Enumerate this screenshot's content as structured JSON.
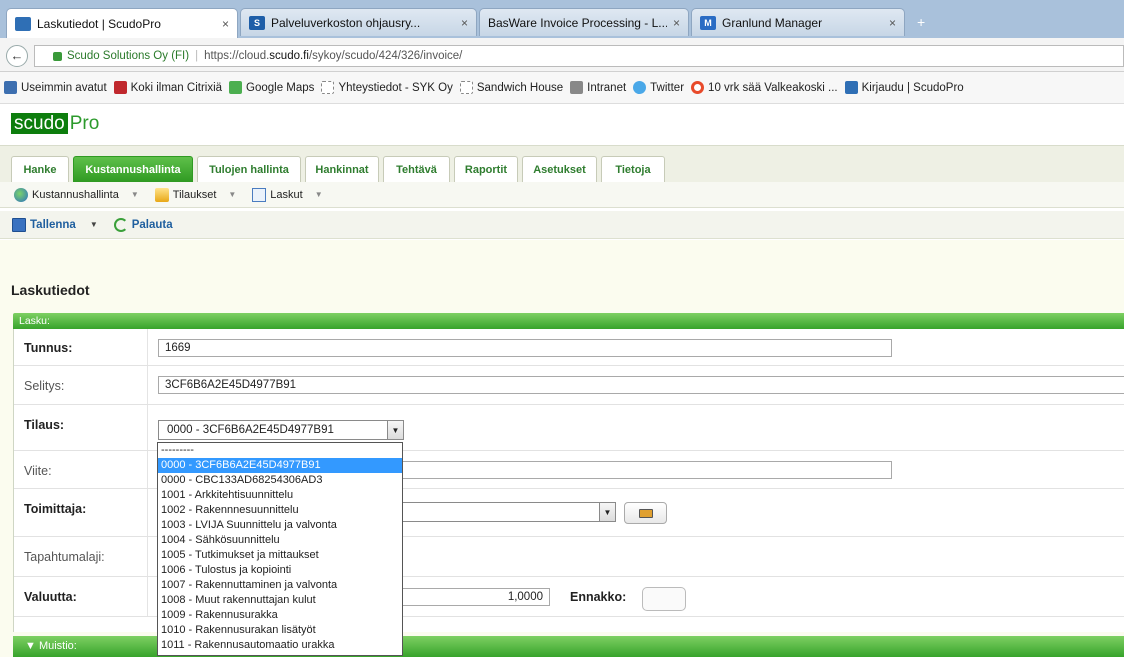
{
  "browser": {
    "tabs": [
      {
        "label": "Laskutiedot | ScudoPro",
        "close": "×",
        "fav_color": "#2f6fb5",
        "fav_text": "",
        "active": true
      },
      {
        "label": "Palveluverkoston ohjausry...",
        "close": "×",
        "fav_color": "#1e5ea8",
        "fav_text": "S",
        "active": false
      },
      {
        "label": "BasWare Invoice Processing - L...",
        "close": "×",
        "fav_color": "",
        "fav_text": "",
        "active": false
      },
      {
        "label": "Granlund Manager",
        "close": "×",
        "fav_color": "#2a6cc4",
        "fav_text": "M",
        "active": false
      }
    ],
    "new_tab": "+",
    "back": "←",
    "org_label": "Scudo Solutions Oy (FI)",
    "url_prefix": "https://cloud.",
    "url_domain": "scudo.fi",
    "url_suffix": "/sykoy/scudo/424/326/invoice/",
    "bookmarks": [
      {
        "label": "Useimmin avatut",
        "color": "#3d6fb0"
      },
      {
        "label": "Koki ilman Citrixiä",
        "color": "#c0282d"
      },
      {
        "label": "Google Maps",
        "color": "#4caf50"
      },
      {
        "label": "Yhteystiedot - SYK Oy",
        "color": "#ffffff"
      },
      {
        "label": "Sandwich House",
        "color": "#ffffff"
      },
      {
        "label": "Intranet",
        "color": "#888888"
      },
      {
        "label": "Twitter",
        "color": "#4aa8e8"
      },
      {
        "label": "10 vrk sää Valkeakoski ...",
        "color": "#e84a2a"
      },
      {
        "label": "Kirjaudu | ScudoPro",
        "color": "#2f6fb5"
      }
    ]
  },
  "app": {
    "logo_scudo": "scudo",
    "logo_pro": "Pro",
    "main_tabs": [
      "Hanke",
      "Kustannushallinta",
      "Tulojen hallinta",
      "Hankinnat",
      "Tehtävä",
      "Raportit",
      "Asetukset",
      "Tietoja"
    ],
    "submenu": [
      "Kustannushallinta",
      "Tilaukset",
      "Laskut"
    ],
    "toolbar": {
      "save": "Tallenna",
      "restore": "Palauta"
    },
    "page_title": "Laskutiedot",
    "panel_title": "Lasku:",
    "fields": {
      "tunnus_label": "Tunnus:",
      "tunnus_value": "1669",
      "selitys_label": "Selitys:",
      "selitys_value": "3CF6B6A2E45D4977B91",
      "tilaus_label": "Tilaus:",
      "tilaus_value": "0000 - 3CF6B6A2E45D4977B91",
      "viite_label": "Viite:",
      "toimittaja_label": "Toimittaja:",
      "tapahtumalaji_label": "Tapahtumalaji:",
      "valuutta_label": "Valuutta:",
      "valuutta_value": "1,0000",
      "ennakko_label": "Ennakko:"
    },
    "dropdown_options": [
      "---------",
      "0000 - 3CF6B6A2E45D4977B91",
      "0000 - CBC133AD68254306AD3",
      "1001 - Arkkitehtisuunnittelu",
      "1002 - Rakennnesuunnittelu",
      "1003 - LVIJA Suunnittelu ja valvonta",
      "1004 - Sähkösuunnittelu",
      "1005 - Tutkimukset ja mittaukset",
      "1006 - Tulostus ja kopiointi",
      "1007 - Rakennuttaminen ja valvonta",
      "1008 - Muut rakennuttajan kulut",
      "1009 - Rakennusurakka",
      "1010 - Rakennusurakan lisätyöt",
      "1011 - Rakennusautomaatio urakka"
    ],
    "dropdown_selected_index": 1,
    "muistio_label": "▼ Muistio:",
    "accent_color": "#37a32b"
  }
}
